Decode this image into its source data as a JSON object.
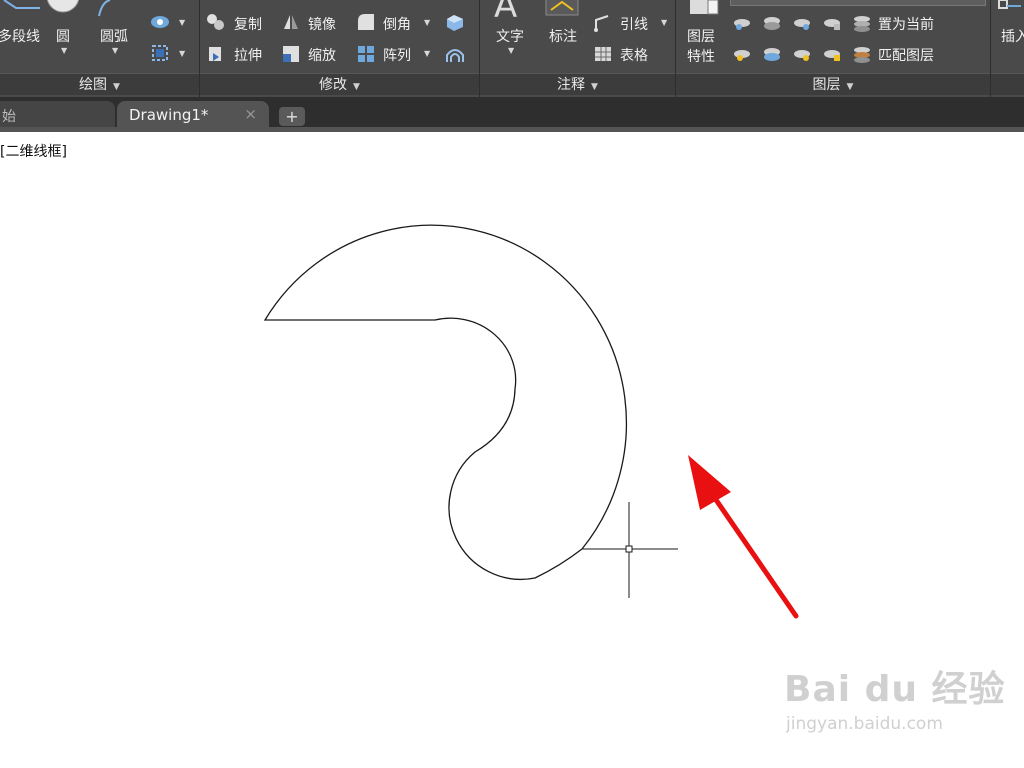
{
  "ribbon": {
    "panels": {
      "draw": "绘图",
      "modify": "修改",
      "annotate": "注释",
      "layers": "图层"
    },
    "draw": {
      "polyline": "多段线",
      "circle": "圆",
      "arc": "圆弧"
    },
    "modify": {
      "copy": "复制",
      "mirror": "镜像",
      "fillet": "倒角",
      "stretch": "拉伸",
      "scale": "缩放",
      "array": "阵列"
    },
    "annotate": {
      "text": "文字",
      "dimension": "标注",
      "leader": "引线",
      "table": "表格"
    },
    "layers": {
      "properties_line1": "图层",
      "properties_line2": "特性",
      "set_current": "置为当前",
      "match_layer": "匹配图层"
    },
    "insert": "插入"
  },
  "tabs": {
    "start": "始",
    "drawing": "Drawing1*",
    "close": "×",
    "add": "+"
  },
  "viewport": {
    "label": "[二维线框]"
  },
  "watermark": {
    "main": "Bai du 经验",
    "sub": "jingyan.baidu.com"
  },
  "colors": {
    "ribbon_bg": "#4a4a4a",
    "tabbar_bg": "#2e2e2e",
    "arrow": "#e81010"
  }
}
